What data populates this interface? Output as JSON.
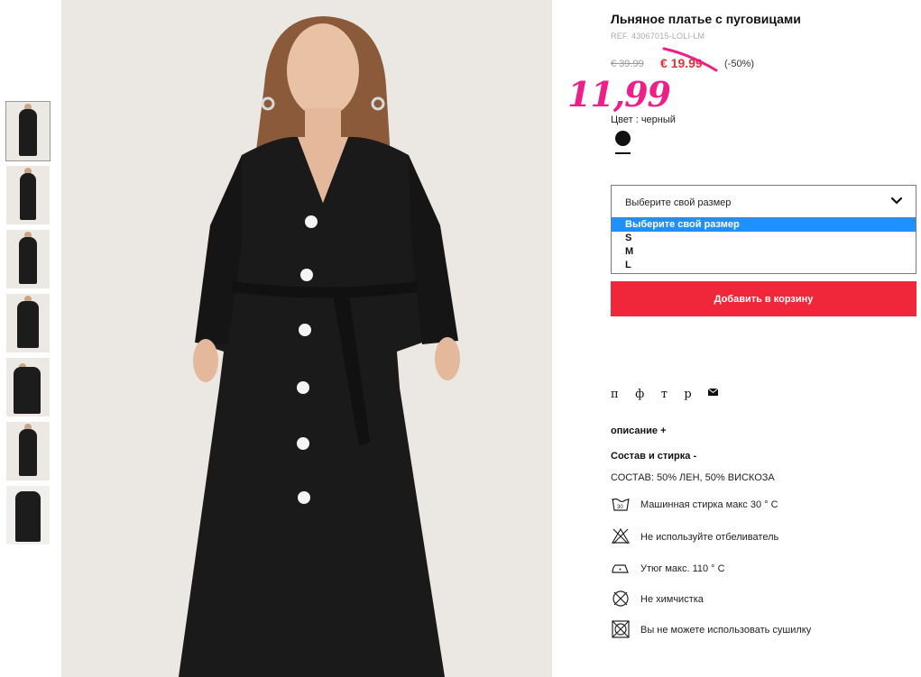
{
  "product": {
    "title": "Льняное платье с пуговицами",
    "ref": "REF. 43067015-LOLI-LM",
    "old_price": "€ 39.99",
    "sale_price": "€ 19.99",
    "discount": "(-50%)",
    "new_price_handwritten": "11,99",
    "color_label": "Цвет : черный",
    "color_value": "черный"
  },
  "size_select": {
    "placeholder": "Выберите свой размер",
    "options": [
      "Выберите свой размер",
      "S",
      "M",
      "L"
    ],
    "selected_index": 0
  },
  "add_to_cart": "Добавить в корзину",
  "share": [
    "п",
    "ф",
    "т",
    "р"
  ],
  "share_mail_icon": "mail-icon",
  "description_toggle": "описание +",
  "composition_toggle": "Состав и стирка -",
  "composition": "СОСТАВ: 50% ЛЕН, 50% ВИСКОЗА",
  "care": [
    {
      "icon": "wash-30-icon",
      "text": "Машинная стирка макс 30 ° С"
    },
    {
      "icon": "no-bleach-icon",
      "text": "Не используйте отбеливатель"
    },
    {
      "icon": "iron-110-icon",
      "text": "Утюг макс. 110 ° С"
    },
    {
      "icon": "no-dry-clean-icon",
      "text": "Не химчистка"
    },
    {
      "icon": "no-tumble-dry-icon",
      "text": "Вы не можете использовать сушилку"
    }
  ],
  "thumbnails_count": 7,
  "colors": {
    "sale_red": "#e0303a",
    "cart_red": "#f0263a",
    "handwritten_pink": "#ef1f8a",
    "select_highlight": "#1e90ff",
    "dress_black": "#1a1a1a"
  }
}
